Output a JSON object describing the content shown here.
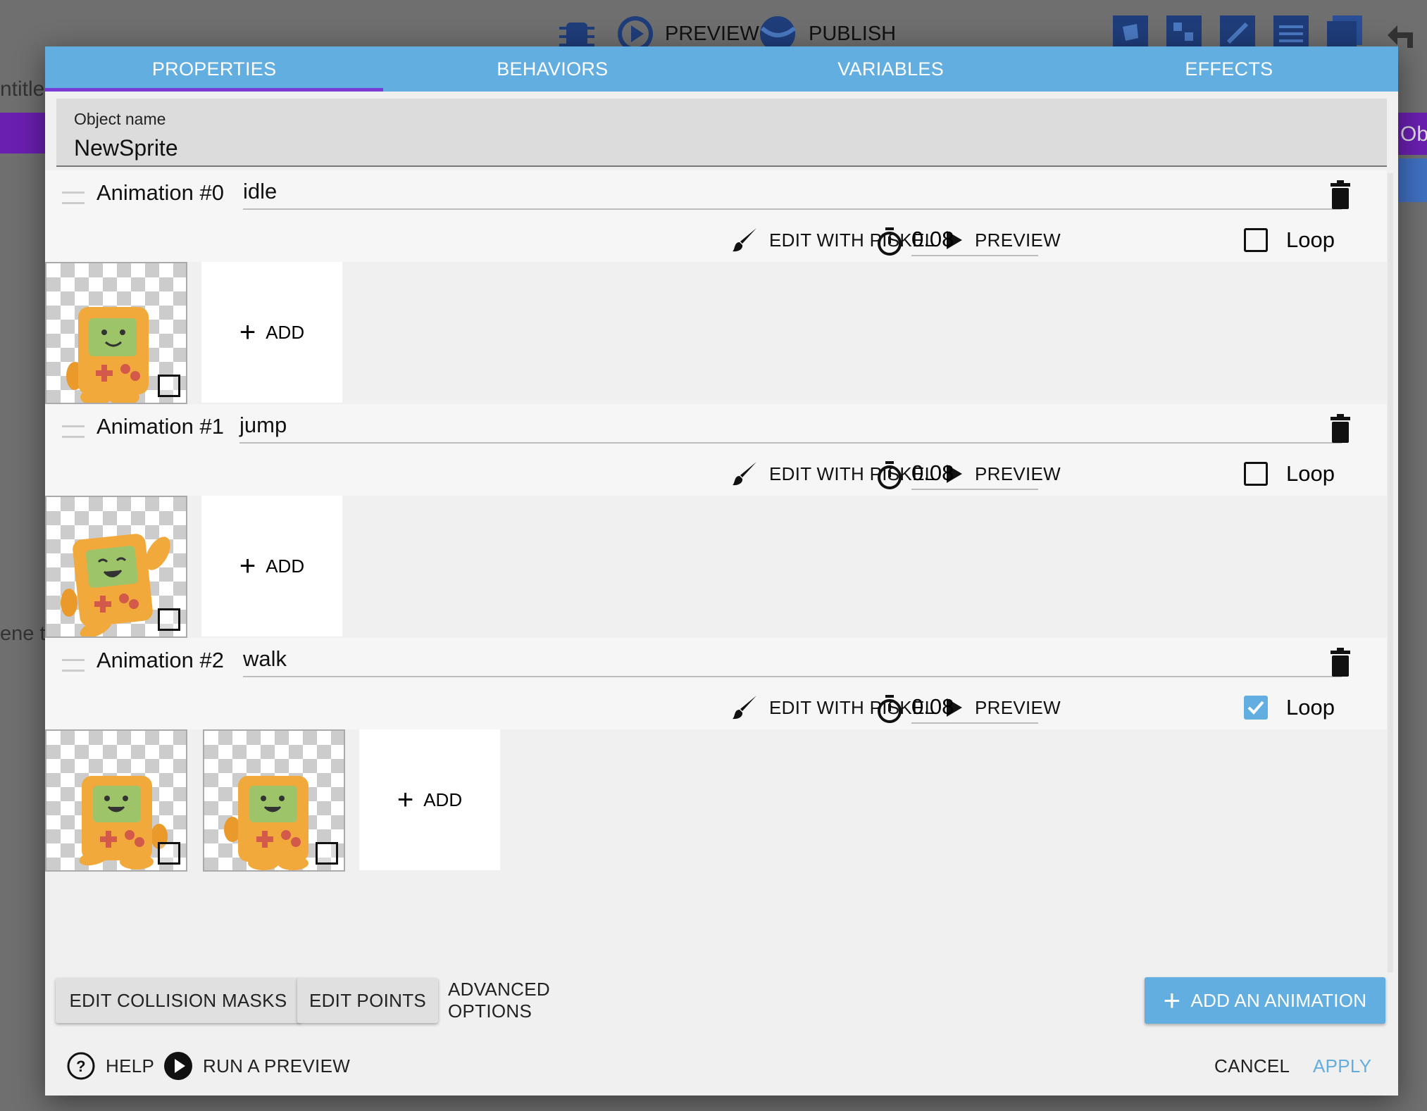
{
  "background": {
    "toolbar": {
      "preview_label": "PREVIEW",
      "publish_label": "PUBLISH"
    },
    "partial_title": "ntitle",
    "partial_object_tab": "Ob",
    "partial_scene_text": "ene to"
  },
  "dialog": {
    "tabs": [
      {
        "label": "PROPERTIES",
        "active": true
      },
      {
        "label": "BEHAVIORS",
        "active": false
      },
      {
        "label": "VARIABLES",
        "active": false
      },
      {
        "label": "EFFECTS",
        "active": false
      }
    ],
    "object_name": {
      "label": "Object name",
      "value": "NewSprite"
    },
    "tool_labels": {
      "edit_with_piskel": "EDIT WITH PISKEL",
      "preview": "PREVIEW",
      "loop": "Loop",
      "add": "ADD"
    },
    "animations": [
      {
        "label": "Animation #0",
        "name": "idle",
        "duration": "0.08",
        "loop": false,
        "frames": 1
      },
      {
        "label": "Animation #1",
        "name": "jump",
        "duration": "0.08",
        "loop": false,
        "frames": 1
      },
      {
        "label": "Animation #2",
        "name": "walk",
        "duration": "0.08",
        "loop": true,
        "frames": 2
      }
    ],
    "actions": {
      "edit_collision_masks": "EDIT COLLISION MASKS",
      "edit_points": "EDIT POINTS",
      "advanced_options": "ADVANCED OPTIONS",
      "add_animation": "ADD AN ANIMATION"
    },
    "footer": {
      "help": "HELP",
      "run_preview": "RUN A PREVIEW",
      "cancel": "CANCEL",
      "apply": "APPLY"
    },
    "colors": {
      "accent": "#63aee0",
      "tab_indicator": "#7a3cd4",
      "sprite_body": "#f2a93b",
      "sprite_screen": "#9ec46a"
    }
  }
}
